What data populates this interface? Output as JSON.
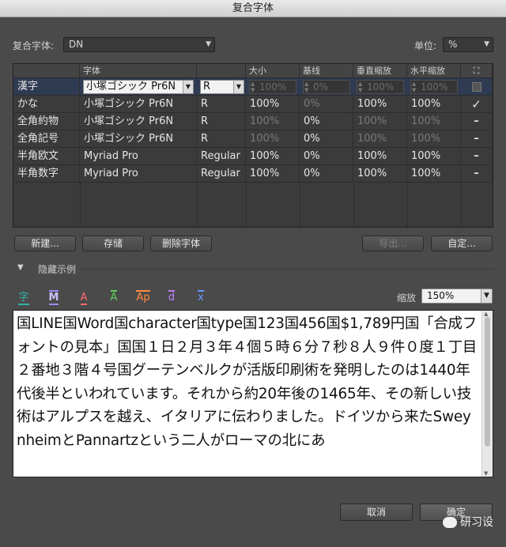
{
  "window": {
    "title": "复合字体"
  },
  "top": {
    "composite_font_label": "复合字体:",
    "composite_font_value": "DN",
    "units_label": "单位:",
    "units_value": "%"
  },
  "table": {
    "headers": [
      "字体",
      "大小",
      "基线",
      "垂直缩放",
      "水平缩放"
    ],
    "rows": [
      {
        "name": "漢字",
        "font": "小塚ゴシック Pr6N",
        "style": "R",
        "size": "100%",
        "baseline": "0%",
        "vscale": "100%",
        "hscale": "100%",
        "check": ""
      },
      {
        "name": "かな",
        "font": "小塚ゴシック Pr6N",
        "style": "R",
        "size": "100%",
        "baseline": "0%",
        "vscale": "100%",
        "hscale": "100%",
        "check": "✓"
      },
      {
        "name": "全角約物",
        "font": "小塚ゴシック Pr6N",
        "style": "R",
        "size": "100%",
        "baseline": "0%",
        "vscale": "100%",
        "hscale": "100%",
        "check": "–"
      },
      {
        "name": "全角記号",
        "font": "小塚ゴシック Pr6N",
        "style": "R",
        "size": "100%",
        "baseline": "0%",
        "vscale": "100%",
        "hscale": "100%",
        "check": "–"
      },
      {
        "name": "半角欧文",
        "font": "Myriad Pro",
        "style": "Regular",
        "size": "100%",
        "baseline": "0%",
        "vscale": "100%",
        "hscale": "100%",
        "check": "–"
      },
      {
        "name": "半角数字",
        "font": "Myriad Pro",
        "style": "Regular",
        "size": "100%",
        "baseline": "0%",
        "vscale": "100%",
        "hscale": "100%",
        "check": "–"
      }
    ]
  },
  "buttons": {
    "new": "新建...",
    "save": "存储",
    "delete": "删除字体",
    "export": "导出...",
    "custom": "自定...",
    "cancel": "取消",
    "ok": "确定"
  },
  "sample": {
    "toggle_label": "隐藏示例",
    "zoom_label": "缩放",
    "zoom_value": "150%",
    "icons": [
      "字",
      "M",
      "A",
      "A",
      "Ap",
      "d",
      "x"
    ],
    "icon_colors": [
      "#33b3a6",
      "#9a8cff",
      "#ff6b6b",
      "#5fd05f",
      "#ff8a3d",
      "#c080ff",
      "#6c9bff"
    ],
    "text": "国LINE国Word国character国type国123国456国$1,789円国「合成フォントの見本」国国１日２月３年４個５時６分７秒８人９件０度１丁目２番地３階４号国グーテンベルクが活版印刷術を発明したのは1440年代後半といわれています。それから約20年後の1465年、その新しい技術はアルプスを越え、イタリアに伝わりました。ドイツから来たSweynheimとPannartzという二人がローマの北にあ"
  },
  "watermark": "研习设"
}
